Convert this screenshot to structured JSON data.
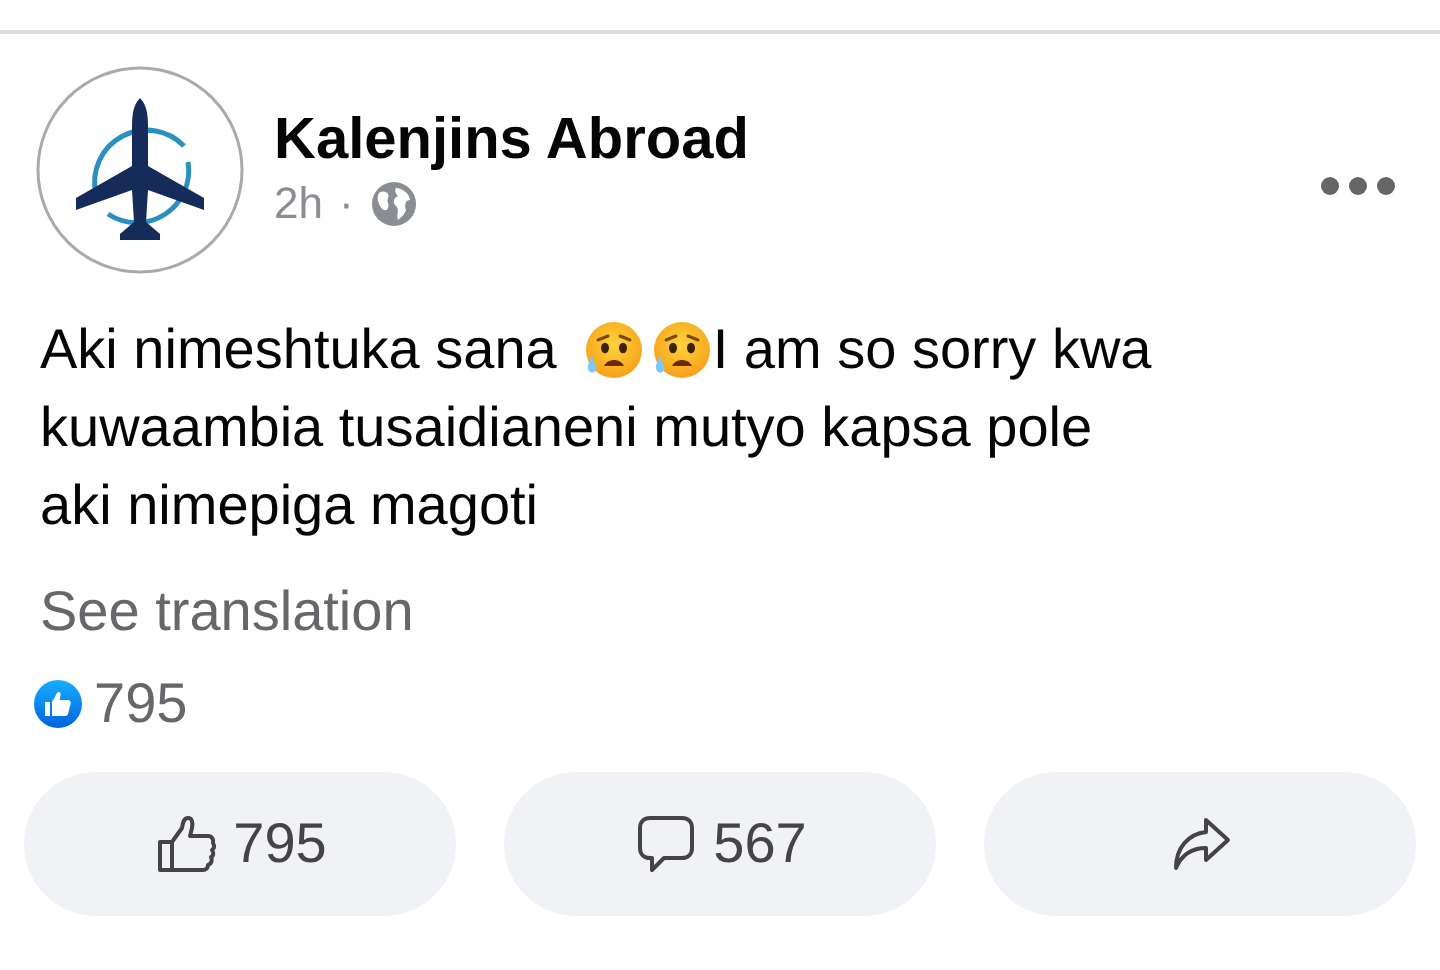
{
  "post": {
    "author": "Kalenjins Abroad",
    "time": "2h",
    "separator": "·",
    "body": [
      [
        {
          "kind": "text",
          "text": "Aki nimeshtuka sana"
        },
        {
          "kind": "emoji"
        },
        {
          "kind": "emoji"
        },
        {
          "kind": "text",
          "text": "I am so sorry kwa"
        }
      ],
      [
        {
          "kind": "text",
          "text": "kuwaambia tusaidianeni mutyo kapsa pole"
        }
      ],
      [
        {
          "kind": "text",
          "text": "aki nimepiga magoti"
        }
      ]
    ],
    "translation_link": "See translation",
    "reaction_count": "795"
  },
  "actions": [
    {
      "kind": "like",
      "label": "795"
    },
    {
      "kind": "comment",
      "label": "567"
    },
    {
      "kind": "share"
    }
  ]
}
